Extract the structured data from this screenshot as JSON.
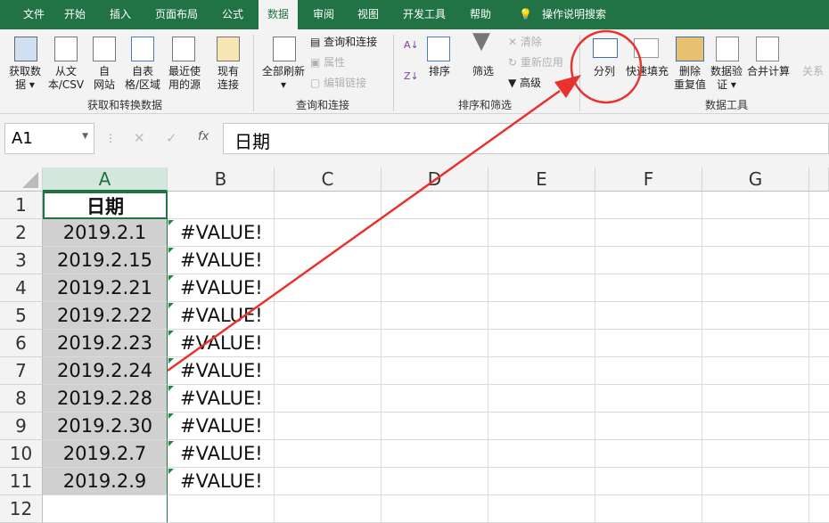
{
  "tabs": [
    "文件",
    "开始",
    "插入",
    "页面布局",
    "公式",
    "数据",
    "审阅",
    "视图",
    "开发工具",
    "帮助"
  ],
  "search_label": "操作说明搜索",
  "ribbon": {
    "get_data": [
      "获取数",
      "据 ▾"
    ],
    "from_csv": [
      "从文",
      "本/CSV"
    ],
    "from_web": [
      "自",
      "网站"
    ],
    "from_table": [
      "自表",
      "格/区域"
    ],
    "recent": [
      "最近使",
      "用的源"
    ],
    "existing": [
      "现有",
      "连接"
    ],
    "group1": "获取和转换数据",
    "refresh_all": "全部刷新",
    "queries": "查询和连接",
    "properties": "属性",
    "edit_links": "编辑链接",
    "group2": "查询和连接",
    "sort": "排序",
    "filter": "筛选",
    "clear": "清除",
    "reapply": "重新应用",
    "advanced": "高级",
    "group3": "排序和筛选",
    "text_to_columns": "分列",
    "flash_fill": "快速填充",
    "remove_dup": [
      "删除",
      "重复值"
    ],
    "validation": [
      "数据验",
      "证 ▾"
    ],
    "consolidate": "合并计算",
    "relations": "关系",
    "group4": "数据工具"
  },
  "formula_bar": {
    "name_box": "A1",
    "fx": "fx",
    "value": "日期"
  },
  "columns": [
    "A",
    "B",
    "C",
    "D",
    "E",
    "F",
    "G"
  ],
  "rows": [
    {
      "n": "1",
      "a": "日期",
      "b": ""
    },
    {
      "n": "2",
      "a": "2019.2.1",
      "b": "#VALUE!"
    },
    {
      "n": "3",
      "a": "2019.2.15",
      "b": "#VALUE!"
    },
    {
      "n": "4",
      "a": "2019.2.21",
      "b": "#VALUE!"
    },
    {
      "n": "5",
      "a": "2019.2.22",
      "b": "#VALUE!"
    },
    {
      "n": "6",
      "a": "2019.2.23",
      "b": "#VALUE!"
    },
    {
      "n": "7",
      "a": "2019.2.24",
      "b": "#VALUE!"
    },
    {
      "n": "8",
      "a": "2019.2.28",
      "b": "#VALUE!"
    },
    {
      "n": "9",
      "a": "2019.2.30",
      "b": "#VALUE!"
    },
    {
      "n": "10",
      "a": "2019.2.7",
      "b": "#VALUE!"
    },
    {
      "n": "11",
      "a": "2019.2.9",
      "b": "#VALUE!"
    },
    {
      "n": "12",
      "a": "",
      "b": ""
    }
  ],
  "annotation_color": "#e8322f"
}
